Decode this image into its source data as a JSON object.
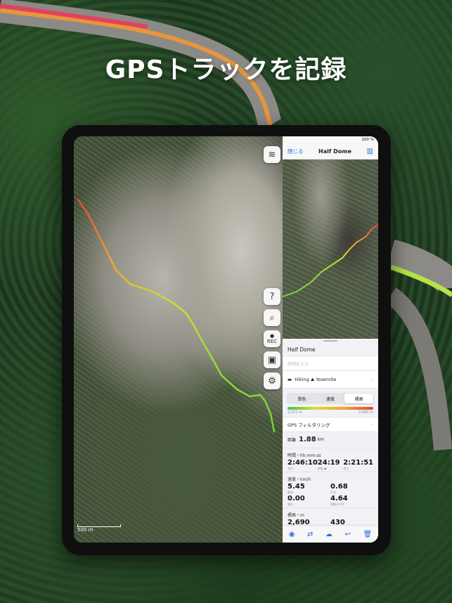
{
  "headline": "GPSトラックを記録",
  "map": {
    "buttons": {
      "layers_icon": "layers-icon",
      "help_label": "?",
      "search_label": "⌕",
      "rec_label": "REC",
      "folder_icon": "folder-icon",
      "settings_label": "⚙"
    },
    "scale_text": "500 m"
  },
  "panel": {
    "status_text": "100 %",
    "close_label": "閉じる",
    "title": "Half Dome",
    "track_title": "Half Dome",
    "description_placeholder": "説明を入力",
    "folder_label": "Hiking ⛰ Yosemite",
    "segments": [
      "単色",
      "速度",
      "標高"
    ],
    "selected_segment": "標高",
    "elevation_min": "2,272 m",
    "elevation_max": "2,690 m",
    "gps_filter_label": "GPS フィルタリング",
    "distance_label": "距離",
    "distance_value": "1.88",
    "distance_unit": "km",
    "time_header": "時間・hh:mm:ss",
    "time_stats": [
      {
        "value": "2:46:10",
        "label": "合計"
      },
      {
        "value": "24:19",
        "label": "移動 ●"
      },
      {
        "value": "2:21:51",
        "label": "停止"
      }
    ],
    "speed_header": "速度・km/h",
    "speed_stats": [
      {
        "value": "5.45",
        "label": "最高"
      },
      {
        "value": "0.68",
        "label": "平均"
      },
      {
        "value": "0.00",
        "label": "最低"
      },
      {
        "value": "4.64",
        "label": "移動の平均"
      }
    ],
    "elevation_header": "標高・m",
    "elevation_stats": [
      {
        "value": "2,690",
        "label": "最高"
      },
      {
        "value": "430",
        "label": "上り"
      }
    ],
    "toolbar_icons": [
      "eye-icon",
      "swap-icon",
      "cloud-icon",
      "undo-icon",
      "trash-icon"
    ]
  }
}
